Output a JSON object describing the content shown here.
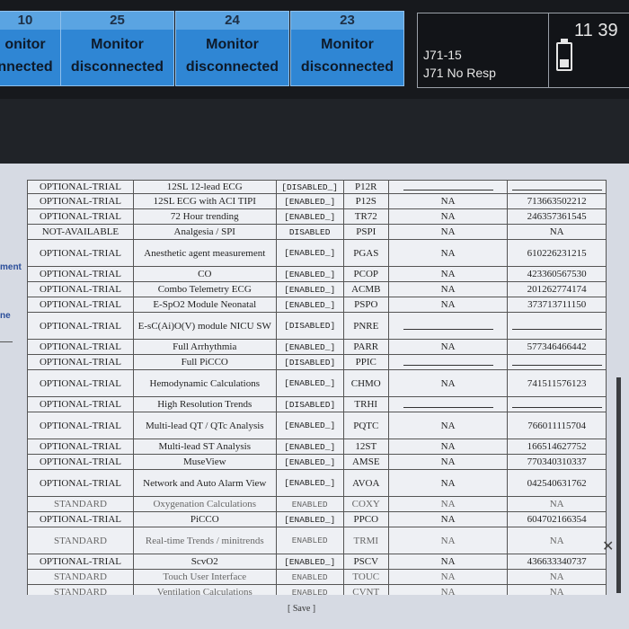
{
  "top_tiles": [
    {
      "num": "10",
      "line1": "onitor",
      "line2": "nnected"
    },
    {
      "num": "25",
      "line1": "Monitor",
      "line2": "disconnected"
    },
    {
      "num": "24",
      "line1": "Monitor",
      "line2": "disconnected"
    },
    {
      "num": "23",
      "line1": "Monitor",
      "line2": "disconnected"
    }
  ],
  "status_box": {
    "line1": "J71-15",
    "line2": "J71 No Resp"
  },
  "clock": "11 39",
  "side_labels": [
    "ment",
    "ne"
  ],
  "rows": [
    {
      "status": "OPTIONAL-TRIAL",
      "feature": "12SL 12-lead ECG",
      "state": "[DISABLED_]",
      "code": "P12R",
      "na": "",
      "key": ""
    },
    {
      "status": "OPTIONAL-TRIAL",
      "feature": "12SL ECG with ACI TIPI",
      "state": "[ENABLED_]",
      "code": "P12S",
      "na": "NA",
      "key": "713663502212"
    },
    {
      "status": "OPTIONAL-TRIAL",
      "feature": "72 Hour trending",
      "state": "[ENABLED_]",
      "code": "TR72",
      "na": "NA",
      "key": "246357361545"
    },
    {
      "status": "NOT-AVAILABLE",
      "feature": "Analgesia / SPI",
      "state": "DISABLED",
      "code": "PSPI",
      "na": "NA",
      "key": "NA"
    },
    {
      "status": "OPTIONAL-TRIAL",
      "feature": "Anesthetic agent measurement",
      "state": "[ENABLED_]",
      "code": "PGAS",
      "na": "NA",
      "key": "610226231215"
    },
    {
      "status": "OPTIONAL-TRIAL",
      "feature": "CO",
      "state": "[ENABLED_]",
      "code": "PCOP",
      "na": "NA",
      "key": "423360567530"
    },
    {
      "status": "OPTIONAL-TRIAL",
      "feature": "Combo Telemetry ECG",
      "state": "[ENABLED_]",
      "code": "ACMB",
      "na": "NA",
      "key": "201262774174"
    },
    {
      "status": "OPTIONAL-TRIAL",
      "feature": "E-SpO2 Module Neonatal",
      "state": "[ENABLED_]",
      "code": "PSPO",
      "na": "NA",
      "key": "373713711150"
    },
    {
      "status": "OPTIONAL-TRIAL",
      "feature": "E-sC(Ai)O(V) module NICU SW",
      "state": "[DISABLED]",
      "code": "PNRE",
      "na": "",
      "key": ""
    },
    {
      "status": "OPTIONAL-TRIAL",
      "feature": "Full Arrhythmia",
      "state": "[ENABLED_]",
      "code": "PARR",
      "na": "NA",
      "key": "577346466442"
    },
    {
      "status": "OPTIONAL-TRIAL",
      "feature": "Full PiCCO",
      "state": "[DISABLED]",
      "code": "PPIC",
      "na": "",
      "key": ""
    },
    {
      "status": "OPTIONAL-TRIAL",
      "feature": "Hemodynamic Calculations",
      "state": "[ENABLED_]",
      "code": "CHMO",
      "na": "NA",
      "key": "741511576123"
    },
    {
      "status": "OPTIONAL-TRIAL",
      "feature": "High Resolution Trends",
      "state": "[DISABLED]",
      "code": "TRHI",
      "na": "",
      "key": ""
    },
    {
      "status": "OPTIONAL-TRIAL",
      "feature": "Multi-lead QT / QTc Analysis",
      "state": "[ENABLED_]",
      "code": "PQTC",
      "na": "NA",
      "key": "766011115704"
    },
    {
      "status": "OPTIONAL-TRIAL",
      "feature": "Multi-lead ST Analysis",
      "state": "[ENABLED_]",
      "code": "12ST",
      "na": "NA",
      "key": "166514627752"
    },
    {
      "status": "OPTIONAL-TRIAL",
      "feature": "MuseView",
      "state": "[ENABLED_]",
      "code": "AMSE",
      "na": "NA",
      "key": "770340310337"
    },
    {
      "status": "OPTIONAL-TRIAL",
      "feature": "Network and Auto Alarm View",
      "state": "[ENABLED_]",
      "code": "AVOA",
      "na": "NA",
      "key": "042540631762"
    },
    {
      "status": "STANDARD",
      "feature": "Oxygenation Calculations",
      "state": "ENABLED",
      "code": "COXY",
      "na": "NA",
      "key": "NA"
    },
    {
      "status": "OPTIONAL-TRIAL",
      "feature": "PiCCO",
      "state": "[ENABLED_]",
      "code": "PPCO",
      "na": "NA",
      "key": "604702166354"
    },
    {
      "status": "STANDARD",
      "feature": "Real-time Trends / minitrends",
      "state": "ENABLED",
      "code": "TRMI",
      "na": "NA",
      "key": "NA"
    },
    {
      "status": "OPTIONAL-TRIAL",
      "feature": "ScvO2",
      "state": "[ENABLED_]",
      "code": "PSCV",
      "na": "NA",
      "key": "436633340737"
    },
    {
      "status": "STANDARD",
      "feature": "Touch User Interface",
      "state": "ENABLED",
      "code": "TOUC",
      "na": "NA",
      "key": "NA"
    },
    {
      "status": "STANDARD",
      "feature": "Ventilation Calculations",
      "state": "ENABLED",
      "code": "CVNT",
      "na": "NA",
      "key": "NA"
    }
  ],
  "save_label": "[ Save ]"
}
